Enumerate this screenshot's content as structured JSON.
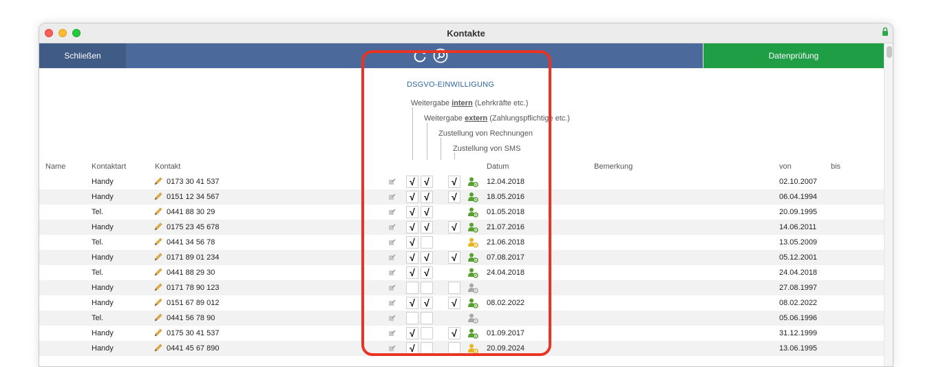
{
  "window": {
    "title": "Kontakte"
  },
  "toolbar": {
    "close_label": "Schließen",
    "check_label": "Datenprüfung"
  },
  "consent": {
    "section_title": "DSGVO-EINWILLIGUNG",
    "intern": {
      "prefix": "Weitergabe ",
      "keyword": "intern",
      "suffix": " (Lehrkräfte etc.)"
    },
    "extern": {
      "prefix": "Weitergabe ",
      "keyword": "extern",
      "suffix": " (Zahlungspflichtige etc.)"
    },
    "invoices": "Zustellung von Rechnungen",
    "sms": "Zustellung von SMS"
  },
  "columns": {
    "name": "Name",
    "type": "Kontaktart",
    "contact": "Kontakt",
    "date": "Datum",
    "remark": "Bemerkung",
    "from": "von",
    "to": "bis"
  },
  "colors": {
    "toolbar": "#4b6a9b",
    "check_button": "#1f9e45",
    "highlight": "#ea3323",
    "person_green": "#55a02e",
    "person_yellow": "#e6b521",
    "person_gray": "#a8a8a8"
  },
  "rows": [
    {
      "type": "Handy",
      "contact": "0173 30 41 537",
      "intern": "√",
      "extern": "√",
      "invoice": false,
      "sms": "√",
      "status": "green",
      "date": "12.04.2018",
      "from": "02.10.2007"
    },
    {
      "type": "Handy",
      "contact": "0151 12 34 567",
      "intern": "√",
      "extern": "√",
      "invoice": false,
      "sms": "√",
      "status": "green",
      "date": "18.05.2016",
      "from": "06.04.1994"
    },
    {
      "type": "Tel.",
      "contact": "0441 88 30 29",
      "intern": "√",
      "extern": "√",
      "invoice": false,
      "sms": null,
      "status": "green",
      "date": "01.05.2018",
      "from": "20.09.1995"
    },
    {
      "type": "Handy",
      "contact": "0175 23 45 678",
      "intern": "√",
      "extern": "√",
      "invoice": false,
      "sms": "√",
      "status": "green",
      "date": "21.07.2016",
      "from": "14.06.2011"
    },
    {
      "type": "Tel.",
      "contact": "0441 34 56 78",
      "intern": "√",
      "extern": "",
      "invoice": false,
      "sms": null,
      "status": "yellow",
      "date": "21.06.2018",
      "from": "13.05.2009"
    },
    {
      "type": "Handy",
      "contact": "0171 89 01 234",
      "intern": "√",
      "extern": "√",
      "invoice": false,
      "sms": "√",
      "status": "green",
      "date": "07.08.2017",
      "from": "05.12.2001"
    },
    {
      "type": "Tel.",
      "contact": "0441 88 29 30",
      "intern": "√",
      "extern": "√",
      "invoice": false,
      "sms": null,
      "status": "green",
      "date": "24.04.2018",
      "from": "24.04.2018"
    },
    {
      "type": "Handy",
      "contact": "0171 78 90 123",
      "intern": "",
      "extern": "",
      "invoice": false,
      "sms": "",
      "status": "gray",
      "date": "",
      "from": "27.08.1997"
    },
    {
      "type": "Handy",
      "contact": "0151 67 89 012",
      "intern": "√",
      "extern": "√",
      "invoice": false,
      "sms": "√",
      "status": "green",
      "date": "08.02.2022",
      "from": "08.02.2022"
    },
    {
      "type": "Tel.",
      "contact": "0441 56 78 90",
      "intern": "",
      "extern": "",
      "invoice": false,
      "sms": null,
      "status": "gray",
      "date": "",
      "from": "05.06.1996"
    },
    {
      "type": "Handy",
      "contact": "0175 30 41 537",
      "intern": "√",
      "extern": "",
      "invoice": false,
      "sms": "√",
      "status": "green",
      "date": "01.09.2017",
      "from": "31.12.1999"
    },
    {
      "type": "Handy",
      "contact": "0441 45 67 890",
      "intern": "√",
      "extern": "",
      "invoice": false,
      "sms": "",
      "status": "yellow",
      "date": "20.09.2024",
      "from": "13.06.1995"
    }
  ]
}
